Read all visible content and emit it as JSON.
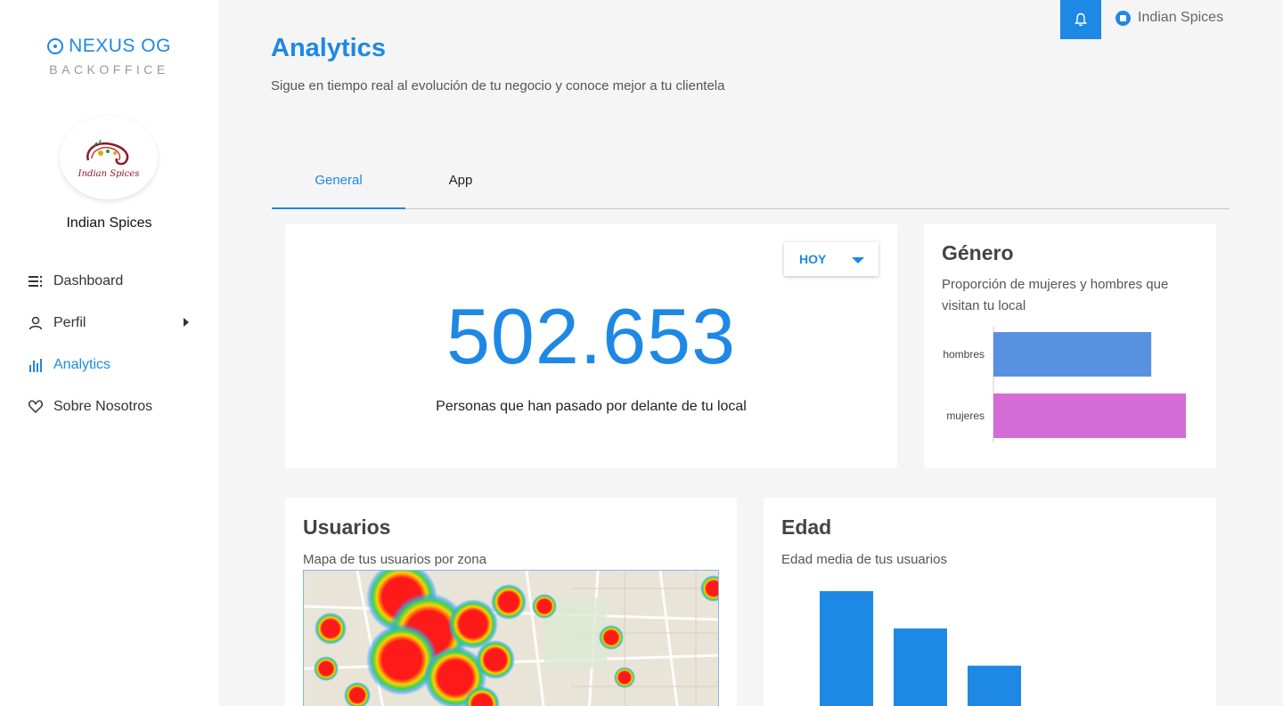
{
  "brand": {
    "name": "NEXUS OG",
    "subtitle": "BACKOFFICE"
  },
  "sidebar": {
    "logo_text": "Indian Spices",
    "shop_name": "Indian Spices",
    "items": [
      {
        "label": "Dashboard",
        "icon": "list-icon"
      },
      {
        "label": "Perfil",
        "icon": "user-icon"
      },
      {
        "label": "Analytics",
        "icon": "bar-chart-icon"
      },
      {
        "label": "Sobre Nosotros",
        "icon": "heart-icon"
      }
    ]
  },
  "header": {
    "user_name": "Indian Spices"
  },
  "page": {
    "title": "Analytics",
    "description": "Sigue en tiempo real al evolución de tu negocio y conoce mejor a tu clientela"
  },
  "tabs": [
    {
      "label": "General"
    },
    {
      "label": "App"
    }
  ],
  "visits": {
    "period": "HOY",
    "number": "502.653",
    "caption": "Personas que han pasado por delante de tu local"
  },
  "gender": {
    "title": "Género",
    "subtitle": "Proporción de mujeres y hombres que visitan tu local"
  },
  "users": {
    "title": "Usuarios",
    "subtitle": "Mapa de tus usuarios por zona"
  },
  "age": {
    "title": "Edad",
    "subtitle": "Edad media de tus usuarios"
  },
  "colors": {
    "accent": "#1e88e5",
    "hombres": "#5891e0",
    "mujeres": "#d56cd5"
  },
  "chart_data": [
    {
      "type": "bar",
      "orientation": "horizontal",
      "categories": [
        "hombres",
        "mujeres"
      ],
      "values": [
        82,
        100
      ],
      "colors": [
        "#5891e0",
        "#d56cd5"
      ],
      "xlim": [
        0,
        100
      ],
      "grid": false
    },
    {
      "type": "bar",
      "categories": [
        "",
        "",
        ""
      ],
      "values": [
        100,
        69,
        38
      ],
      "ylim": [
        0,
        100
      ],
      "grid": false
    }
  ]
}
